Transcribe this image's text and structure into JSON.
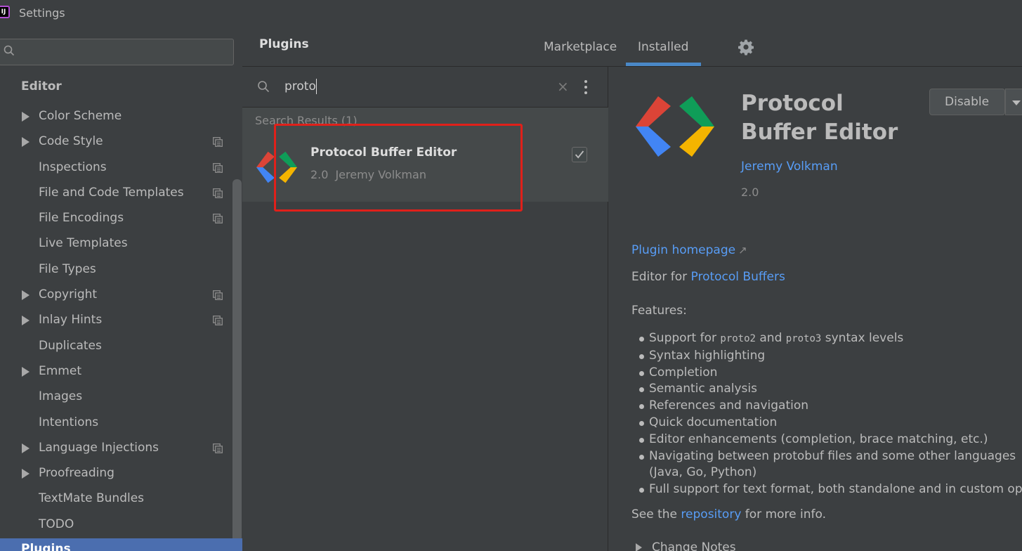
{
  "window": {
    "title": "Settings",
    "app_icon_text": "IJ"
  },
  "sidebar": {
    "search": {
      "value": "",
      "placeholder": ""
    },
    "section_heading": "Editor",
    "items": [
      {
        "label": "Color Scheme",
        "expandable": true,
        "has_copy": false
      },
      {
        "label": "Code Style",
        "expandable": true,
        "has_copy": true
      },
      {
        "label": "Inspections",
        "expandable": false,
        "has_copy": true
      },
      {
        "label": "File and Code Templates",
        "expandable": false,
        "has_copy": true
      },
      {
        "label": "File Encodings",
        "expandable": false,
        "has_copy": true
      },
      {
        "label": "Live Templates",
        "expandable": false,
        "has_copy": false
      },
      {
        "label": "File Types",
        "expandable": false,
        "has_copy": false
      },
      {
        "label": "Copyright",
        "expandable": true,
        "has_copy": true
      },
      {
        "label": "Inlay Hints",
        "expandable": true,
        "has_copy": true
      },
      {
        "label": "Duplicates",
        "expandable": false,
        "has_copy": false
      },
      {
        "label": "Emmet",
        "expandable": true,
        "has_copy": false
      },
      {
        "label": "Images",
        "expandable": false,
        "has_copy": false
      },
      {
        "label": "Intentions",
        "expandable": false,
        "has_copy": false
      },
      {
        "label": "Language Injections",
        "expandable": true,
        "has_copy": true
      },
      {
        "label": "Proofreading",
        "expandable": true,
        "has_copy": false
      },
      {
        "label": "TextMate Bundles",
        "expandable": false,
        "has_copy": false
      },
      {
        "label": "TODO",
        "expandable": false,
        "has_copy": false
      }
    ],
    "selected_item": "Plugins"
  },
  "plugins": {
    "title": "Plugins",
    "tabs": [
      {
        "label": "Marketplace",
        "active": false
      },
      {
        "label": "Installed",
        "active": true
      }
    ],
    "search_query": "proto",
    "results_header": "Search Results (1)",
    "results": [
      {
        "name": "Protocol Buffer Editor",
        "version": "2.0",
        "author": "Jeremy Volkman",
        "enabled": true
      }
    ]
  },
  "detail": {
    "title": "Protocol Buffer Editor",
    "disable_label": "Disable",
    "author": "Jeremy Volkman",
    "version": "2.0",
    "homepage_label": "Plugin homepage",
    "homepage_arrow": "↗",
    "desc_prefix": "Editor for ",
    "desc_link": "Protocol Buffers",
    "features_heading": "Features:",
    "feature_support": {
      "prefix": "Support for ",
      "code1": "proto2",
      "middle": " and ",
      "code2": "proto3",
      "suffix": " syntax levels"
    },
    "features": [
      "Syntax highlighting",
      "Completion",
      "Semantic analysis",
      "References and navigation",
      "Quick documentation",
      "Editor enhancements (completion, brace matching, etc.)"
    ],
    "feature_navigating": "Navigating between protobuf files and some other languages",
    "feature_navigating_cont": "(Java, Go, Python)",
    "feature_full_support": "Full support for text format, both standalone and in custom options",
    "see_prefix": "See the ",
    "see_link": "repository",
    "see_suffix": " for more info.",
    "change_notes_label": "Change Notes"
  },
  "colors": {
    "accent": "#4a88c7",
    "link": "#589df6",
    "selection": "#4b6eaf",
    "highlight_box": "#e0201a"
  }
}
